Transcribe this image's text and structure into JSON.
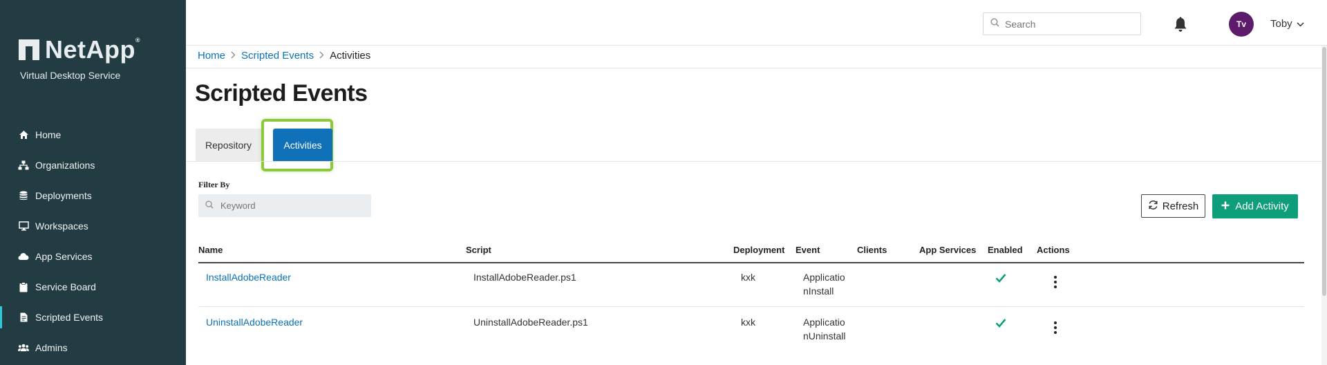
{
  "sidebar": {
    "logo_text": "NetApp",
    "subtitle": "Virtual Desktop Service",
    "items": [
      {
        "label": "Home",
        "icon": "home-icon"
      },
      {
        "label": "Organizations",
        "icon": "sitemap-icon"
      },
      {
        "label": "Deployments",
        "icon": "database-icon"
      },
      {
        "label": "Workspaces",
        "icon": "monitor-icon"
      },
      {
        "label": "App Services",
        "icon": "cloud-icon"
      },
      {
        "label": "Service Board",
        "icon": "clipboard-icon"
      },
      {
        "label": "Scripted Events",
        "icon": "file-script-icon",
        "active": true
      },
      {
        "label": "Admins",
        "icon": "users-icon"
      }
    ]
  },
  "header": {
    "search_placeholder": "Search",
    "avatar_initials": "Tv",
    "user_name": "Toby"
  },
  "breadcrumb": {
    "home": "Home",
    "scripted_events": "Scripted Events",
    "current": "Activities"
  },
  "page_title": "Scripted Events",
  "tabs": {
    "repository": "Repository",
    "activities": "Activities"
  },
  "filter": {
    "label": "Filter By",
    "placeholder": "Keyword"
  },
  "actions": {
    "refresh": "Refresh",
    "add_activity": "Add Activity"
  },
  "table": {
    "headers": {
      "name": "Name",
      "script": "Script",
      "deployment": "Deployment",
      "event": "Event",
      "clients": "Clients",
      "app_services": "App Services",
      "enabled": "Enabled",
      "actions": "Actions"
    },
    "rows": [
      {
        "name": "InstallAdobeReader",
        "script": "InstallAdobeReader.ps1",
        "deployment": "kxk",
        "event": "ApplicationInstall",
        "enabled": true
      },
      {
        "name": "UninstallAdobeReader",
        "script": "UninstallAdobeReader.ps1",
        "deployment": "kxk",
        "event": "ApplicationUninstall",
        "enabled": true
      }
    ]
  },
  "colors": {
    "sidebar_bg": "#233b42",
    "link": "#0b72b5",
    "tab_active": "#1071b9",
    "highlight": "#8dc63f",
    "add_button": "#0e9e79",
    "check": "#0e9e79",
    "avatar_bg": "#5d1b6c"
  }
}
